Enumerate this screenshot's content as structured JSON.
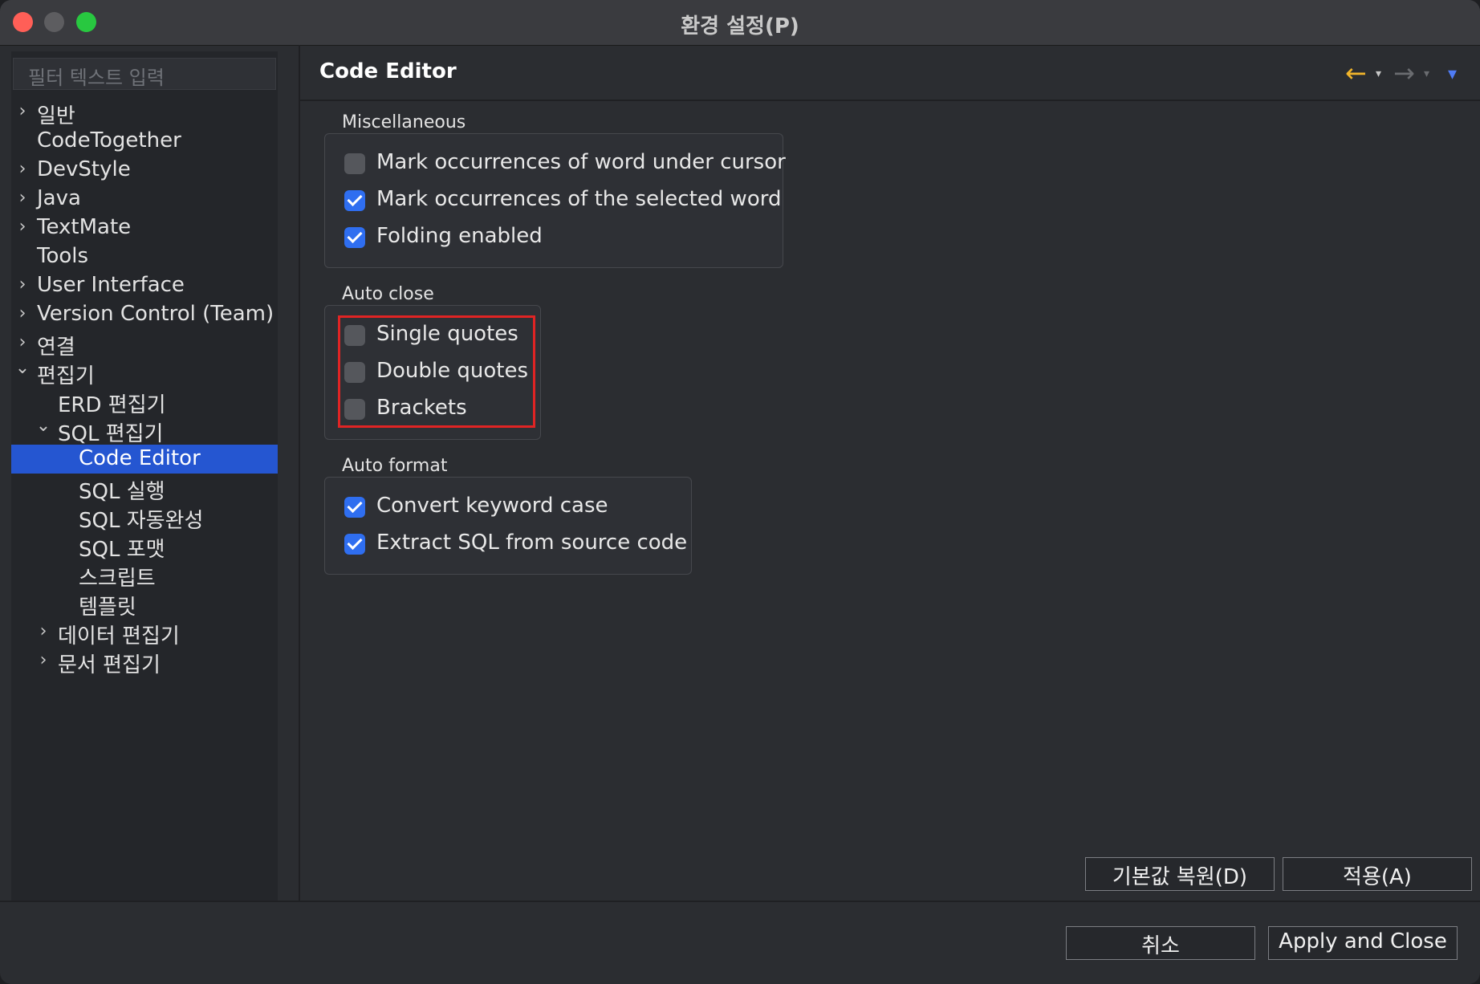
{
  "window": {
    "title": "환경 설정(P)"
  },
  "sidebar": {
    "filter_placeholder": "필터 텍스트 입력",
    "items": [
      {
        "label": "일반",
        "chevron": "›"
      },
      {
        "label": "CodeTogether",
        "chevron": ""
      },
      {
        "label": "DevStyle",
        "chevron": "›"
      },
      {
        "label": "Java",
        "chevron": "›"
      },
      {
        "label": "TextMate",
        "chevron": "›"
      },
      {
        "label": "Tools",
        "chevron": ""
      },
      {
        "label": "User Interface",
        "chevron": "›"
      },
      {
        "label": "Version Control (Team)",
        "chevron": "›"
      },
      {
        "label": "연결",
        "chevron": "›"
      },
      {
        "label": "편집기",
        "chevron": "⌄"
      },
      {
        "label": "ERD 편집기",
        "chevron": ""
      },
      {
        "label": "SQL 편집기",
        "chevron": "⌄"
      },
      {
        "label": "Code Editor",
        "chevron": ""
      },
      {
        "label": "SQL 실행",
        "chevron": ""
      },
      {
        "label": "SQL 자동완성",
        "chevron": ""
      },
      {
        "label": "SQL 포맷",
        "chevron": ""
      },
      {
        "label": "스크립트",
        "chevron": ""
      },
      {
        "label": "템플릿",
        "chevron": ""
      },
      {
        "label": "데이터 편집기",
        "chevron": "›"
      },
      {
        "label": "문서 편집기",
        "chevron": "›"
      }
    ]
  },
  "main": {
    "title": "Code Editor",
    "nav_back_icon": "←",
    "nav_forward_icon": "→",
    "nav_dropdown_icon": "▾",
    "groups": {
      "misc": {
        "label": "Miscellaneous",
        "options": [
          {
            "label": "Mark occurrences of word under cursor",
            "checked": false
          },
          {
            "label": "Mark occurrences of the selected word",
            "checked": true
          },
          {
            "label": "Folding enabled",
            "checked": true
          }
        ]
      },
      "autoclose": {
        "label": "Auto close",
        "options": [
          {
            "label": "Single quotes",
            "checked": false
          },
          {
            "label": "Double quotes",
            "checked": false
          },
          {
            "label": "Brackets",
            "checked": false
          }
        ]
      },
      "autoformat": {
        "label": "Auto format",
        "options": [
          {
            "label": "Convert keyword case",
            "checked": true
          },
          {
            "label": "Extract SQL from source code",
            "checked": true
          }
        ]
      }
    },
    "restore_defaults_label": "기본값 복원(D)",
    "apply_label": "적용(A)"
  },
  "footer": {
    "cancel_label": "취소",
    "apply_close_label": "Apply and Close"
  },
  "colors": {
    "accent": "#2556d1",
    "highlight": "#e02424",
    "back_arrow": "#f2b52b"
  }
}
